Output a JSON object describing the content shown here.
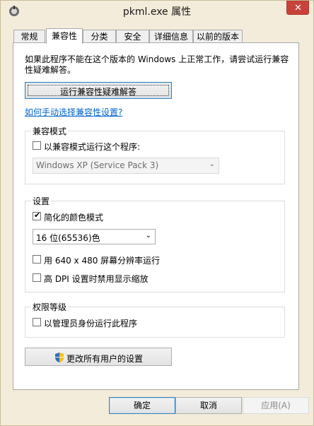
{
  "window": {
    "title": "pkml.exe 属性",
    "close_glyph": "✕"
  },
  "tabs": [
    {
      "label": "常规"
    },
    {
      "label": "兼容性",
      "active": true
    },
    {
      "label": "分类"
    },
    {
      "label": "安全"
    },
    {
      "label": "详细信息"
    },
    {
      "label": "以前的版本"
    }
  ],
  "compat": {
    "intro": "如果此程序不能在这个版本的 Windows 上正常工作，请尝试运行兼容性疑难解答。",
    "troubleshoot_button": "运行兼容性疑难解答",
    "manual_link": "如何手动选择兼容性设置?",
    "mode_group": {
      "label": "兼容模式",
      "checkbox": {
        "label": "以兼容模式运行这个程序:",
        "checked": false
      },
      "os_select": {
        "value": "Windows XP (Service Pack 3)",
        "enabled": false
      }
    },
    "settings_group": {
      "label": "设置",
      "reduced_color": {
        "label": "简化的颜色模式",
        "checked": true
      },
      "color_select": {
        "value": "16 位(65536)色"
      },
      "resolution_640": {
        "label": "用 640 x 480 屏幕分辨率运行",
        "checked": false
      },
      "high_dpi": {
        "label": "高 DPI 设置时禁用显示缩放",
        "checked": false
      }
    },
    "privilege_group": {
      "label": "权限等级",
      "run_as_admin": {
        "label": "以管理员身份运行此程序",
        "checked": false
      }
    },
    "all_users_button": "更改所有用户的设置"
  },
  "footer": {
    "ok": "确定",
    "cancel": "取消",
    "apply": "应用(A)"
  },
  "icons": {
    "checkmark": "✔",
    "chevron": "⌄"
  }
}
